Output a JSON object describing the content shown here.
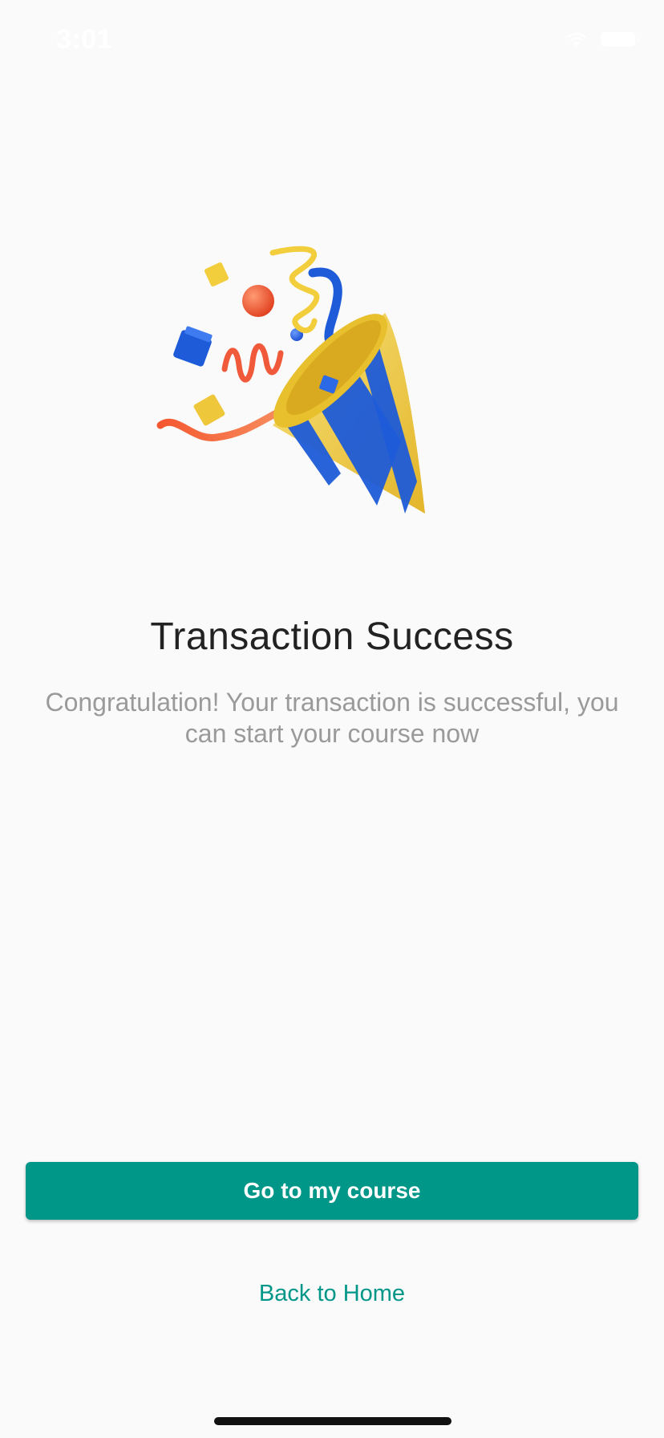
{
  "status_bar": {
    "time": "3:01",
    "icons": [
      "wifi-icon",
      "battery-icon"
    ]
  },
  "illustration": {
    "name": "party-popper-illustration",
    "colors": {
      "yellow": "#f2cd3c",
      "blue": "#1e5bd8",
      "orange": "#f26a3d",
      "red": "#ef4a2c"
    }
  },
  "content": {
    "title": "Transaction Success",
    "message": "Congratulation! Your transaction is successful, you can start your course now"
  },
  "actions": {
    "primary_label": "Go to my course",
    "secondary_label": "Back to Home"
  },
  "theme": {
    "accent": "#009688",
    "background": "#fafafa",
    "title_color": "#222222",
    "message_color": "#9a9a9a"
  }
}
